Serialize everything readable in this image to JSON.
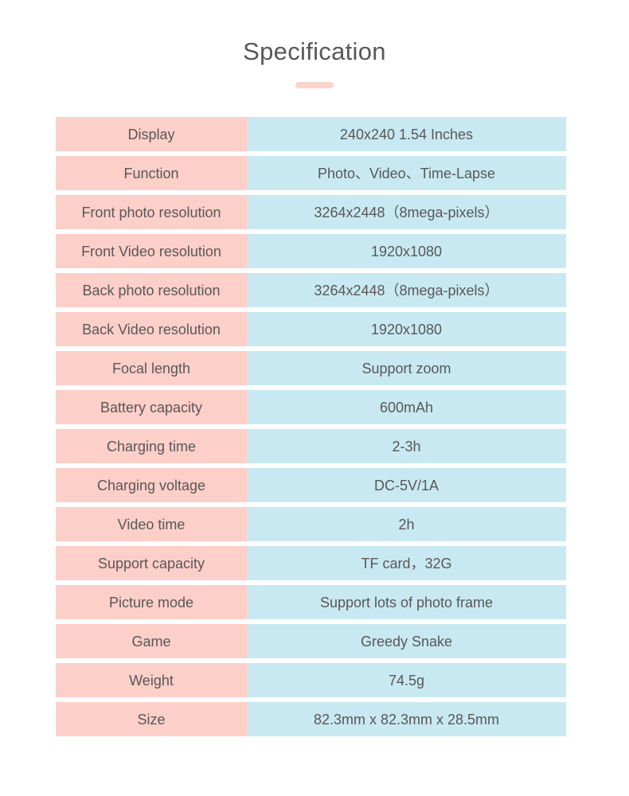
{
  "header": {
    "title": "Specification"
  },
  "spec_table": {
    "rows": [
      {
        "label": "Display",
        "value": "240x240  1.54 Inches"
      },
      {
        "label": "Function",
        "value": "Photo、Video、Time-Lapse"
      },
      {
        "label": "Front photo resolution",
        "value": "3264x2448（8mega-pixels）"
      },
      {
        "label": "Front Video resolution",
        "value": "1920x1080"
      },
      {
        "label": "Back photo resolution",
        "value": "3264x2448（8mega-pixels）"
      },
      {
        "label": "Back Video resolution",
        "value": "1920x1080"
      },
      {
        "label": "Focal length",
        "value": "Support zoom"
      },
      {
        "label": "Battery capacity",
        "value": "600mAh"
      },
      {
        "label": "Charging time",
        "value": "2-3h"
      },
      {
        "label": "Charging voltage",
        "value": "DC-5V/1A"
      },
      {
        "label": "Video time",
        "value": "2h"
      },
      {
        "label": "Support capacity",
        "value": "TF card，32G"
      },
      {
        "label": "Picture mode",
        "value": "Support lots of photo frame"
      },
      {
        "label": "Game",
        "value": "Greedy Snake"
      },
      {
        "label": "Weight",
        "value": "74.5g"
      },
      {
        "label": "Size",
        "value": "82.3mm x 82.3mm x 28.5mm"
      }
    ]
  },
  "colors": {
    "label_background": "#fdcfc9",
    "value_background": "#c8e9f2",
    "text": "#595757",
    "accent": "#fbd3cd",
    "page_background": "#ffffff"
  }
}
